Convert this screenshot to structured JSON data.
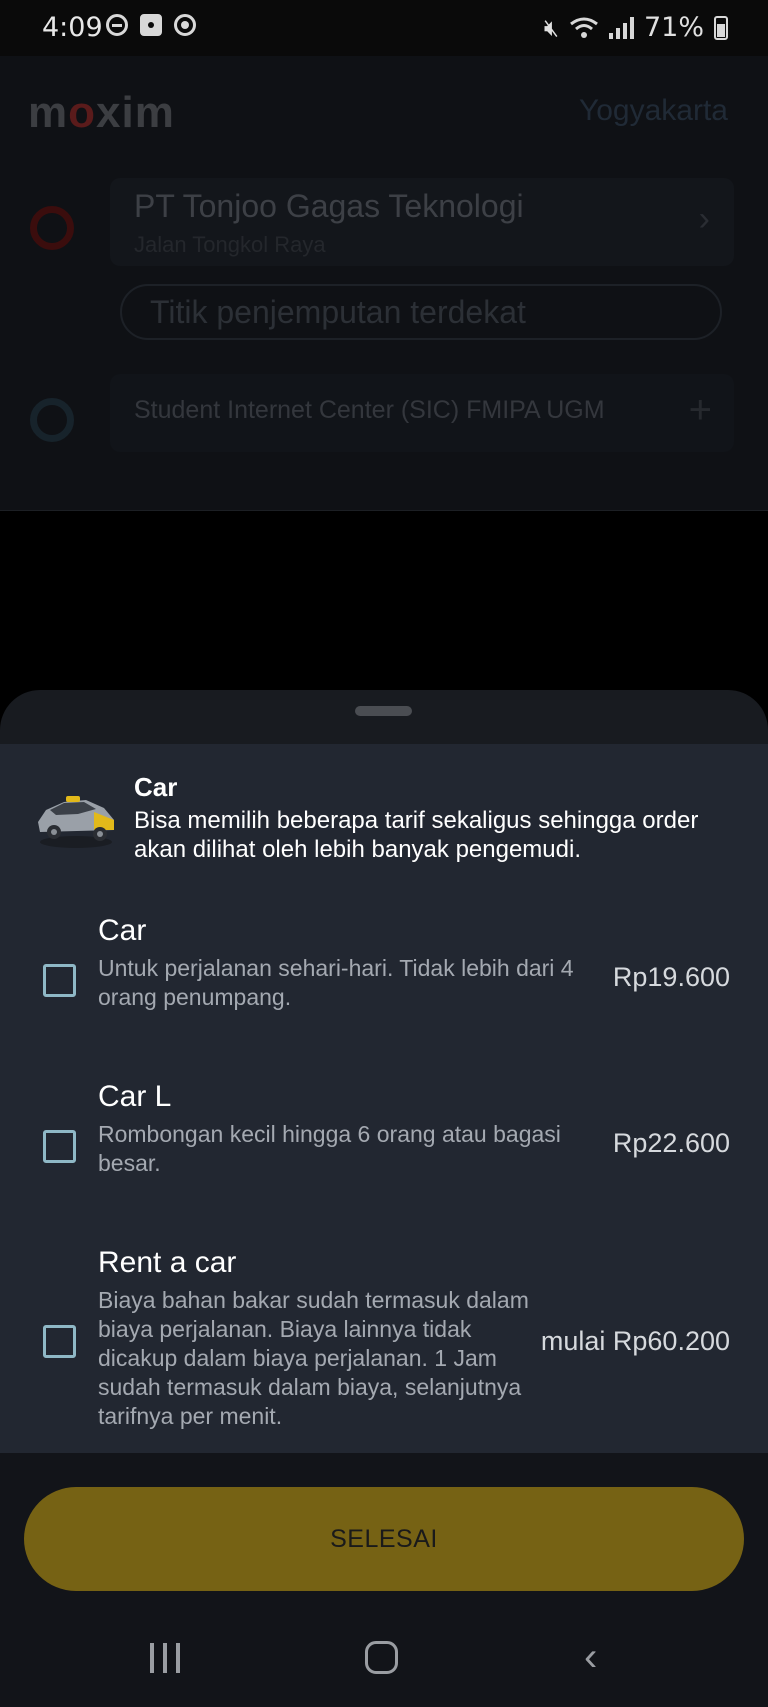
{
  "status_bar": {
    "time": "4:09",
    "battery": "71%"
  },
  "background": {
    "logo": {
      "prefix": "m",
      "o": "o",
      "suffix": "xim"
    },
    "city": "Yogyakarta",
    "pickup": {
      "title": "PT Tonjoo Gagas Teknologi",
      "subtitle": "Jalan Tongkol Raya"
    },
    "nearest_pickup_placeholder": "Titik penjemputan terdekat",
    "destination": "Student Internet Center (SIC) FMIPA UGM"
  },
  "sheet": {
    "header": {
      "title": "Car",
      "description": "Bisa memilih beberapa tarif sekaligus sehingga order akan dilihat oleh lebih banyak pengemudi."
    },
    "options": [
      {
        "title": "Car",
        "description": "Untuk perjalanan sehari-hari. Tidak lebih dari 4 orang penumpang.",
        "price": "Rp19.600",
        "checked": false
      },
      {
        "title": "Car L",
        "description": "Rombongan kecil hingga 6 orang atau bagasi besar.",
        "price": "Rp22.600",
        "checked": false
      },
      {
        "title": "Rent a car",
        "description": "Biaya bahan bakar sudah termasuk dalam biaya perjalanan. Biaya lainnya tidak dicakup dalam biaya perjalanan. 1 Jam sudah termasuk dalam biaya, selanjutnya tarifnya per menit.",
        "price": "mulai Rp60.200",
        "checked": false
      }
    ],
    "done_label": "SELESAI"
  },
  "colors": {
    "accent": "#766214",
    "checkbox": "#8fb8c6",
    "sheet_bg": "#222731"
  }
}
